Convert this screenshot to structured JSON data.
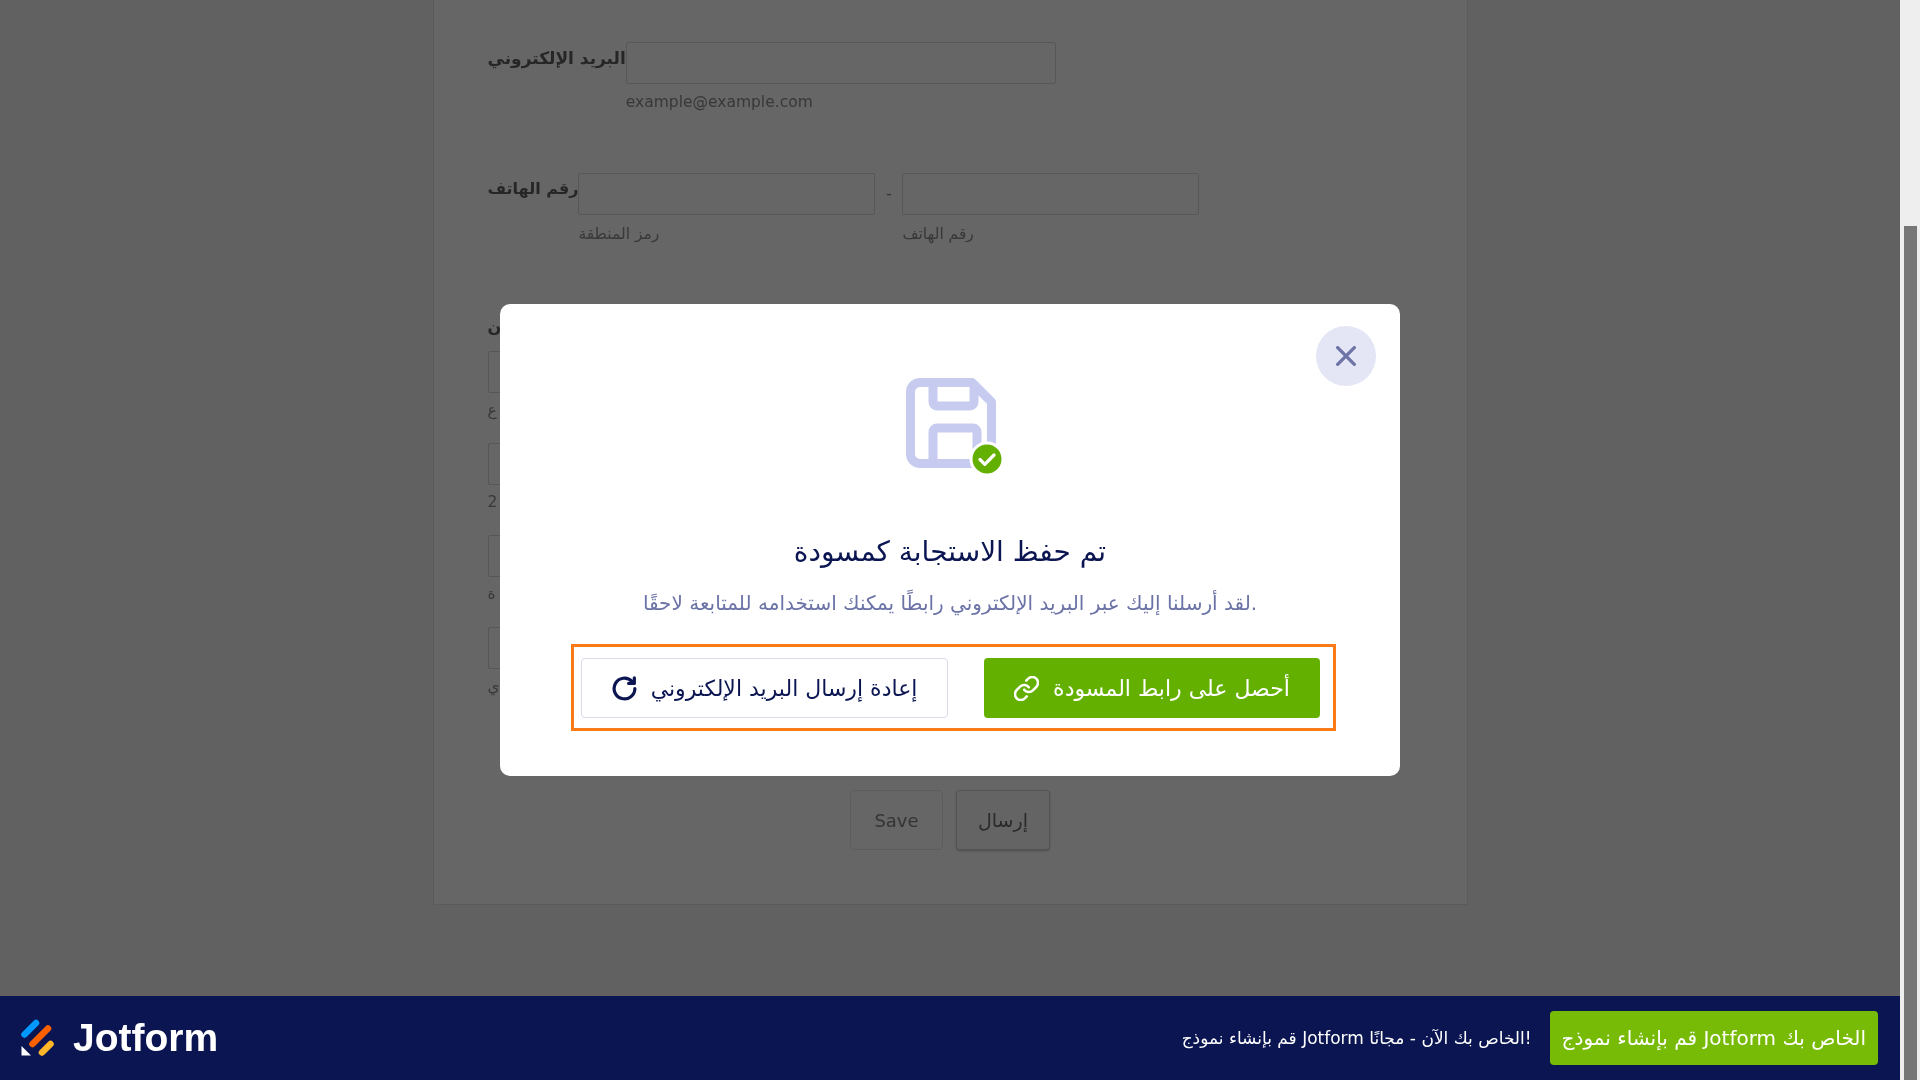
{
  "form": {
    "fields": [
      {
        "kind": "email",
        "label": "البريد الإلكتروني",
        "inputs": [
          {
            "sublabel": "example@example.com"
          }
        ]
      },
      {
        "kind": "phone",
        "label": "رقم الهاتف",
        "separator": "-",
        "inputs": [
          {
            "sublabel": "رقم الهاتف"
          },
          {
            "sublabel": "رمز المنطقة"
          }
        ]
      },
      {
        "kind": "address",
        "label": "ن",
        "inputs": [
          {
            "sublabel": "ع"
          },
          {
            "sublabel": "2"
          },
          {
            "sublabel": "ة"
          },
          {
            "sublabel": "ي"
          }
        ]
      }
    ],
    "buttons": [
      {
        "kind": "submit",
        "label": "إرسال"
      },
      {
        "kind": "save",
        "label": "Save"
      }
    ]
  },
  "dialog": {
    "title": "تم حفظ الاستجابة كمسودة",
    "message": "لقد أرسلنا إليك عبر البريد الإلكتروني رابطًا يمكنك استخدامه للمتابعة لاحقًا.",
    "highlighted": true,
    "actions": [
      {
        "kind": "primary",
        "label": "أحصل على رابط المسودة"
      },
      {
        "kind": "secondary",
        "label": "إعادة إرسال البريد الإلكتروني"
      }
    ]
  },
  "footer": {
    "brand": "Jotform",
    "promo": "قم بإنشاء نموذج Jotform الخاص بك الآن - مجانًا!",
    "button": "قم بإنشاء نموذج Jotform الخاص بك"
  }
}
